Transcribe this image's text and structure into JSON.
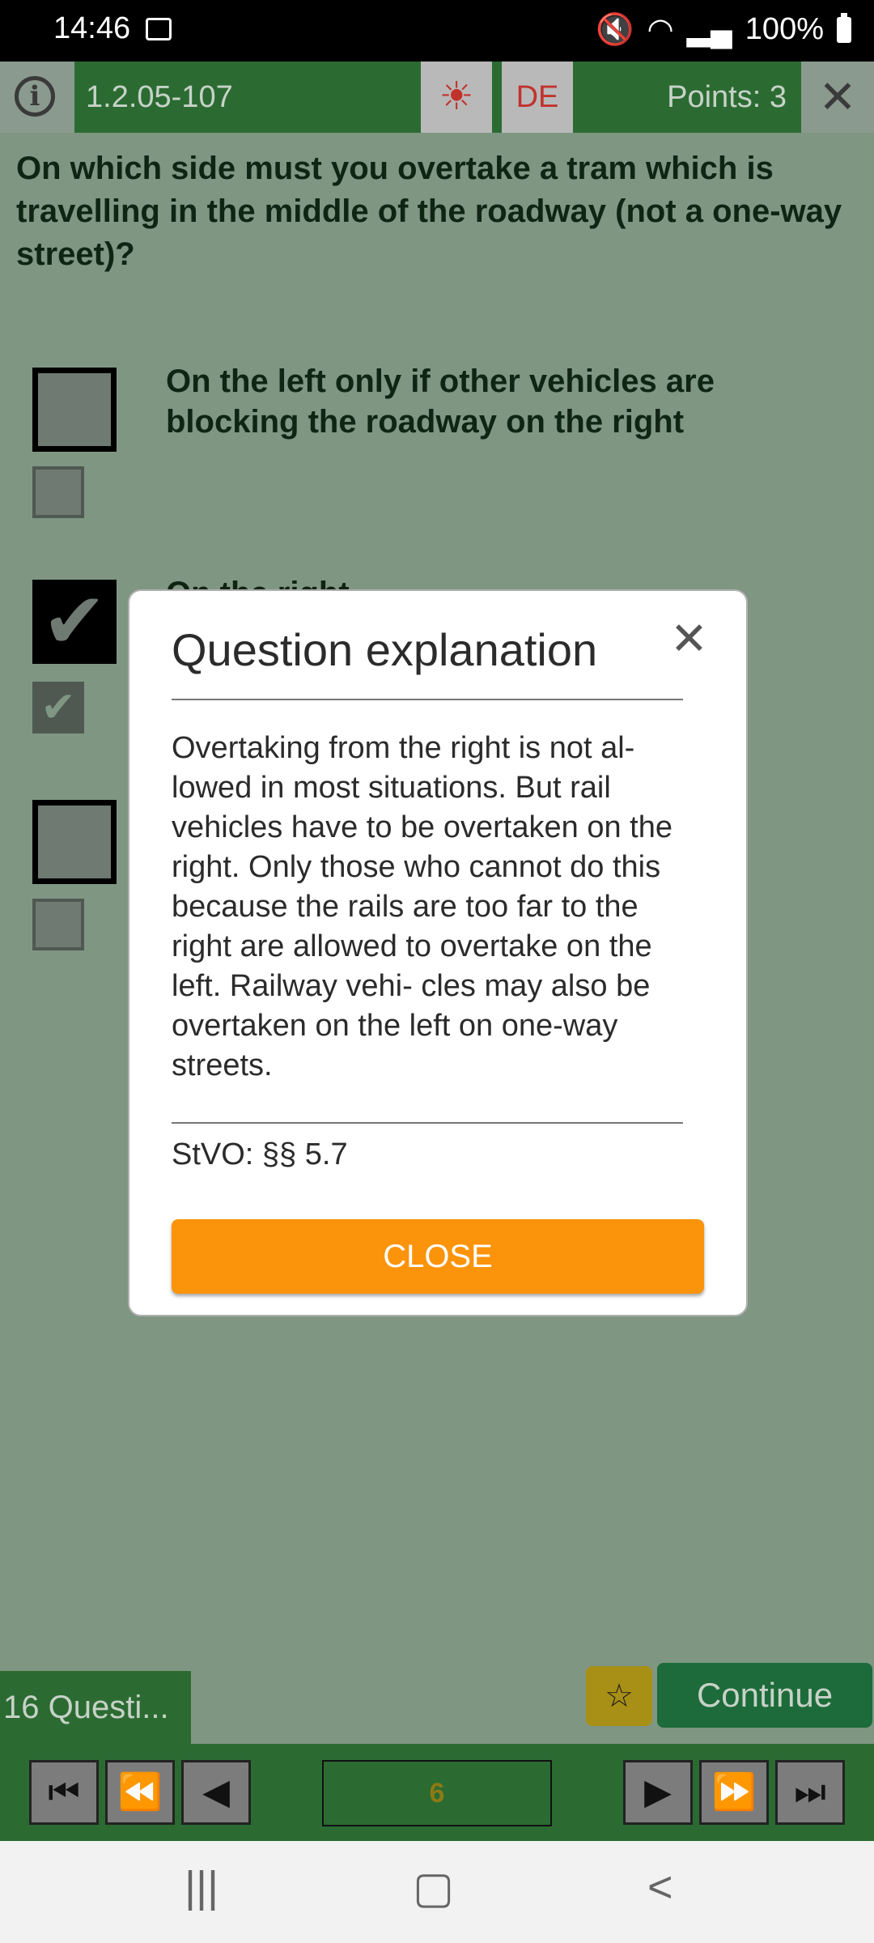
{
  "status": {
    "time": "14:46",
    "battery": "100%"
  },
  "header": {
    "question_id": "1.2.05-107",
    "language": "DE",
    "points": "Points: 3",
    "close_symbol": "✕",
    "info_symbol": "i",
    "hint_symbol": "☀"
  },
  "question": {
    "text": "On which side must you overtake a tram which is travelling in the middle of the roadway (not a one-way street)?",
    "answers": [
      {
        "text": "On the left only if other vehicles are blocking the roadway on the right",
        "checked": false
      },
      {
        "text": "On the right",
        "checked": true
      },
      {
        "text": "",
        "checked": false
      }
    ]
  },
  "dialog": {
    "title": "Question explanation",
    "close_symbol": "✕",
    "body": "Overtaking from the right is not al- lowed in most situations. But rail vehicles have to be overtaken on the right. Only those who cannot do this because the rails are too far to the right are allowed to overtake on the left. Railway vehi- cles may also be overtaken on the left on one-way streets.",
    "reference": "StVO: §§ 5.7",
    "button": "CLOSE"
  },
  "footer": {
    "question_count": "16 Questi...",
    "star_symbol": "☆",
    "continue": "Continue",
    "page": "6",
    "nav": {
      "first": "⏮",
      "prev_fast": "⏪",
      "prev": "◀",
      "next": "▶",
      "next_fast": "⏩",
      "last": "⏭"
    }
  },
  "system_nav": {
    "recents": "|||",
    "home": "▢",
    "back": "<"
  },
  "colors": {
    "accent": "#fb930b",
    "header_green": "#2b6b32",
    "background": "#7f9683"
  }
}
